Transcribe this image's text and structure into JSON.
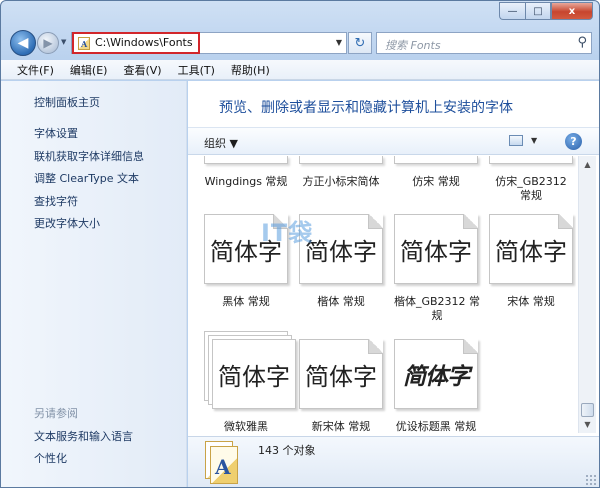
{
  "window": {
    "minimize": "—",
    "maximize": "□",
    "close": "x"
  },
  "nav": {
    "back_glyph": "◀",
    "forward_glyph": "▶",
    "dropdown_glyph": "▼",
    "address_value": "C:\\Windows\\Fonts",
    "address_dropdown_glyph": "▼",
    "refresh_glyph": "↻",
    "search_placeholder": "搜索 Fonts",
    "search_icon_glyph": "⚲"
  },
  "menu": [
    "文件(F)",
    "编辑(E)",
    "查看(V)",
    "工具(T)",
    "帮助(H)"
  ],
  "sidebar": {
    "links": [
      "控制面板主页",
      "字体设置",
      "联机获取字体详细信息",
      "调整 ClearType 文本",
      "查找字符",
      "更改字体大小"
    ],
    "see_also_heading": "另请参阅",
    "see_also_links": [
      "文本服务和输入语言",
      "个性化"
    ]
  },
  "content": {
    "heading": "预览、删除或者显示和隐藏计算机上安装的字体",
    "toolbar": {
      "organize_label": "组织 ▼",
      "view_dropdown": "▼",
      "help": "?"
    },
    "watermark": "IT袋",
    "fonts_row_top": [
      {
        "name": "Wingdings 常规"
      },
      {
        "name": "方正小标宋简体"
      },
      {
        "name": "仿宋 常规"
      },
      {
        "name": "仿宋_GB2312 常规"
      }
    ],
    "fonts": [
      {
        "name": "黑体 常规",
        "preview": "简体字"
      },
      {
        "name": "楷体 常规",
        "preview": "简体字"
      },
      {
        "name": "楷体_GB2312 常规",
        "preview": "简体字"
      },
      {
        "name": "宋体 常规",
        "preview": "简体字"
      },
      {
        "name": "微软雅黑",
        "preview": "简体字"
      },
      {
        "name": "新宋体 常规",
        "preview": "简体字"
      },
      {
        "name": "优设标题黑 常规",
        "preview": "简体字"
      }
    ],
    "scroll_up": "▲",
    "scroll_down": "▼"
  },
  "status": {
    "count": "143 个对象",
    "icon_letter": "A"
  },
  "colors": {
    "address_highlight": "#d2262b",
    "heading": "#1e4f9c",
    "link": "#1e3a64"
  }
}
